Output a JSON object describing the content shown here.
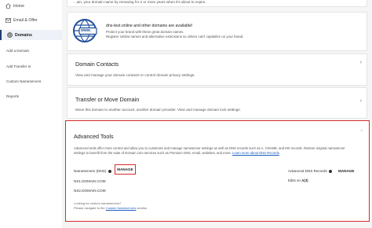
{
  "sidebar": {
    "items": [
      {
        "label": "Home"
      },
      {
        "label": "Email & Offer"
      },
      {
        "label": "Domains"
      }
    ],
    "sub_items": [
      {
        "label": "Add a Domain"
      },
      {
        "label": "Add Transfer In"
      },
      {
        "label": "Custom Nameservers"
      },
      {
        "label": "Reports"
      }
    ]
  },
  "top_card": {
    "text": "...ain, your domain name by renewing for 2 or more years when it's about to expire."
  },
  "promo": {
    "title": "dns-test.online and other domains are available!",
    "line1": "Protect your brand with these great domain names.",
    "line2": "Register similar names and alternative extensions so others can't capitalize on your brand.",
    "icon_text": "www."
  },
  "domain_contacts": {
    "title": "Domain Contacts",
    "desc": "View and manage your domain contacts or control domain privacy settings."
  },
  "transfer": {
    "title": "Transfer or Move Domain",
    "desc": "Move this domain to another account, another domain provider. View and manage domain lock settings."
  },
  "advanced": {
    "title": "Advanced Tools",
    "desc": "Advanced tools offer more control and allow you to customize and manage nameserver settings as well as DNS records such as A, CNAME, and MX records. Restore original nameserver settings to benefit from the suite of Domain.com services such as Premium DNS, email, websites, and more.",
    "learn_more": "Learn more about DNS Records",
    "nameservers_label": "Nameservers (DNS)",
    "manage_label": "MANAGE",
    "ns1": "NS1.DOMAIN.COM",
    "ns2": "NS2.DOMAIN.COM",
    "dns_records_label": "Advanced DNS Records",
    "dns_manage_label": "MANAGE",
    "edits_prefix": "Edits on",
    "edits_value": "A(3)",
    "looking_line1": "Looking for custom nameservers?",
    "looking_line2_prefix": "Please navigate to the",
    "looking_link": "Custom Nameservers",
    "looking_line2_suffix": "section."
  }
}
